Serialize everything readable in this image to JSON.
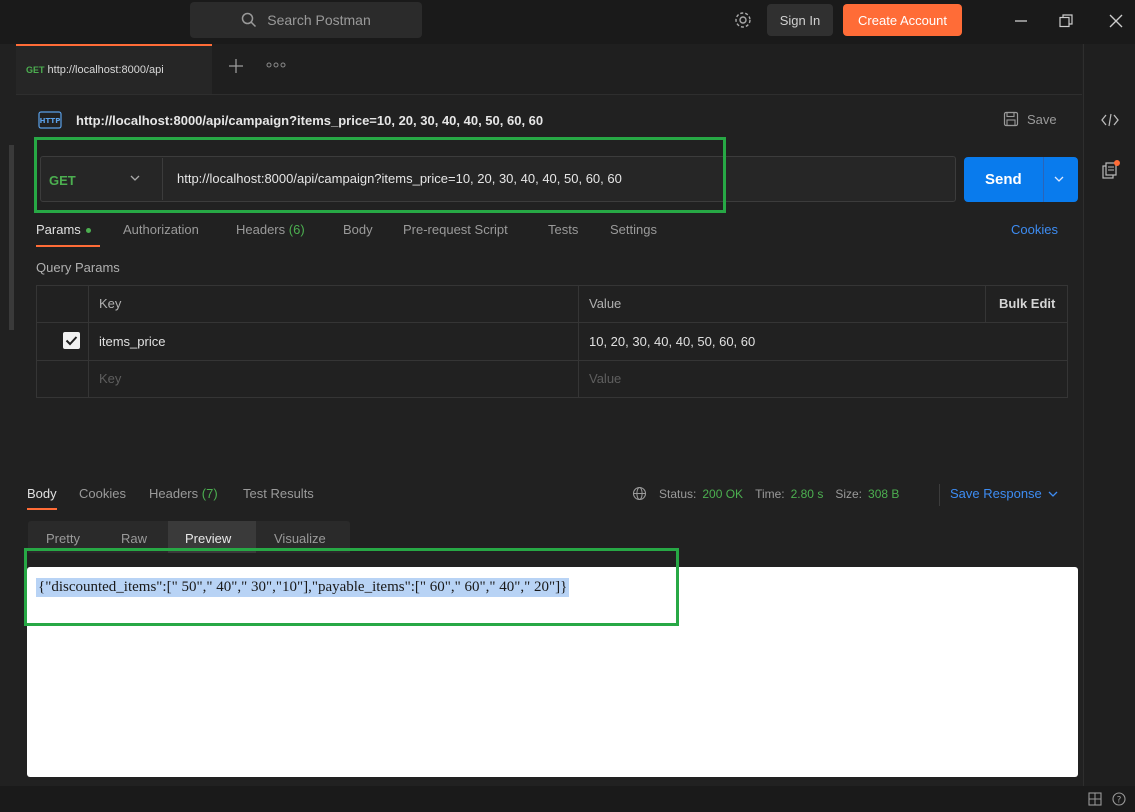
{
  "topbar": {
    "search_placeholder": "Search Postman",
    "signin_label": "Sign In",
    "create_account_label": "Create Account"
  },
  "tab": {
    "method": "GET",
    "title": "http://localhost:8000/api"
  },
  "request": {
    "title": "http://localhost:8000/api/campaign?items_price=10, 20, 30, 40, 40, 50, 60, 60",
    "save_label": "Save",
    "method": "GET",
    "url": "http://localhost:8000/api/campaign?items_price=10, 20, 30, 40, 40, 50, 60, 60",
    "send_label": "Send"
  },
  "request_tabs": {
    "params": "Params",
    "authorization": "Authorization",
    "headers": "Headers",
    "headers_count": "(6)",
    "body": "Body",
    "pre_request": "Pre-request Script",
    "tests": "Tests",
    "settings": "Settings",
    "cookies": "Cookies"
  },
  "query_params": {
    "label": "Query Params",
    "header_key": "Key",
    "header_value": "Value",
    "bulk_edit": "Bulk Edit",
    "rows": [
      {
        "key": "items_price",
        "value": "10, 20, 30, 40, 40, 50, 60, 60"
      }
    ],
    "placeholder_key": "Key",
    "placeholder_value": "Value"
  },
  "response": {
    "tabs": {
      "body": "Body",
      "cookies": "Cookies",
      "headers": "Headers",
      "headers_count": "(7)",
      "test_results": "Test Results"
    },
    "status_label": "Status:",
    "status_value": "200 OK",
    "time_label": "Time:",
    "time_value": "2.80 s",
    "size_label": "Size:",
    "size_value": "308 B",
    "save_response": "Save Response",
    "view_tabs": {
      "pretty": "Pretty",
      "raw": "Raw",
      "preview": "Preview",
      "visualize": "Visualize"
    },
    "preview_text": "{\"discounted_items\":[\" 50\",\" 40\",\" 30\",\"10\"],\"payable_items\":[\" 60\",\" 60\",\" 40\",\" 20\"]}"
  },
  "colors": {
    "accent": "#ff6c37",
    "send": "#097bed",
    "get_method": "#4caf50",
    "highlight_box": "#27a845"
  }
}
